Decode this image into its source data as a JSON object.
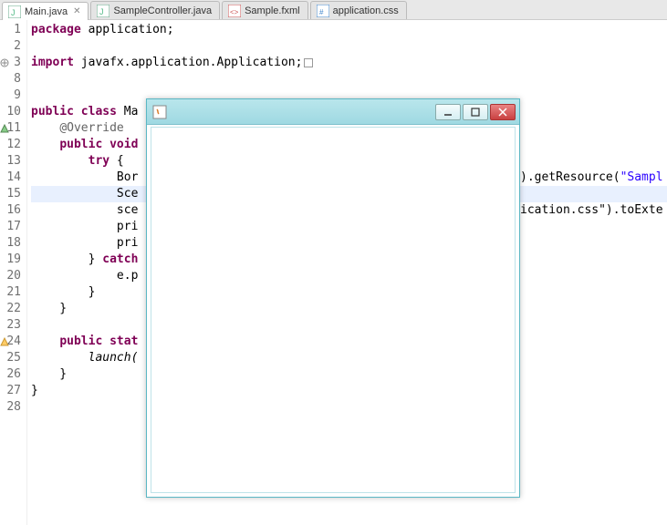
{
  "tabs": [
    {
      "label": "Main.java",
      "icon": "java-file-icon",
      "active": true,
      "closable": true
    },
    {
      "label": "SampleController.java",
      "icon": "java-file-icon",
      "active": false,
      "closable": false
    },
    {
      "label": "Sample.fxml",
      "icon": "fxml-file-icon",
      "active": false,
      "closable": false
    },
    {
      "label": "application.css",
      "icon": "css-file-icon",
      "active": false,
      "closable": false
    }
  ],
  "gutter": {
    "lines": [
      "1",
      "2",
      "3",
      "8",
      "9",
      "10",
      "11",
      "12",
      "13",
      "14",
      "15",
      "16",
      "17",
      "18",
      "19",
      "20",
      "21",
      "22",
      "23",
      "24",
      "25",
      "26",
      "27",
      "28"
    ],
    "fold_marker_line": "3",
    "override_marker_line": "11",
    "warning_marker_line": "24"
  },
  "code": {
    "lines": [
      {
        "tokens": [
          [
            "kw",
            "package"
          ],
          [
            "",
            " application;"
          ]
        ]
      },
      {
        "tokens": []
      },
      {
        "tokens": [
          [
            "kw",
            "import"
          ],
          [
            "",
            " javafx.application.Application;"
          ]
        ],
        "eolbox": true
      },
      {
        "tokens": []
      },
      {
        "tokens": []
      },
      {
        "tokens": [
          [
            "kw",
            "public class"
          ],
          [
            "",
            " Ma"
          ]
        ]
      },
      {
        "tokens": [
          [
            "",
            "    "
          ],
          [
            "ann",
            "@Override"
          ]
        ]
      },
      {
        "tokens": [
          [
            "",
            "    "
          ],
          [
            "kw",
            "public void"
          ]
        ]
      },
      {
        "tokens": [
          [
            "",
            "        "
          ],
          [
            "kw",
            "try"
          ],
          [
            "",
            " {"
          ]
        ]
      },
      {
        "tokens": [
          [
            "",
            "            Bor"
          ]
        ],
        "tail": [
          [
            "",
            ").getResource("
          ],
          [
            "str",
            "\"Sampl"
          ]
        ]
      },
      {
        "tokens": [
          [
            "",
            "            Sce"
          ]
        ],
        "highlight": true
      },
      {
        "tokens": [
          [
            "",
            "            sce"
          ]
        ],
        "tail": [
          [
            "",
            "ication.css\""
          ],
          [
            "",
            ").toExte"
          ]
        ]
      },
      {
        "tokens": [
          [
            "",
            "            pri"
          ]
        ]
      },
      {
        "tokens": [
          [
            "",
            "            pri"
          ]
        ]
      },
      {
        "tokens": [
          [
            "",
            "        } "
          ],
          [
            "kw",
            "catch"
          ]
        ]
      },
      {
        "tokens": [
          [
            "",
            "            e.p"
          ]
        ]
      },
      {
        "tokens": [
          [
            "",
            "        }"
          ]
        ]
      },
      {
        "tokens": [
          [
            "",
            "    }"
          ]
        ]
      },
      {
        "tokens": []
      },
      {
        "tokens": [
          [
            "",
            "    "
          ],
          [
            "kw",
            "public stat"
          ]
        ]
      },
      {
        "tokens": [
          [
            "",
            "        "
          ],
          [
            "",
            "launch("
          ]
        ],
        "italic": true
      },
      {
        "tokens": [
          [
            "",
            "    }"
          ]
        ]
      },
      {
        "tokens": [
          [
            "",
            "}"
          ]
        ]
      },
      {
        "tokens": []
      }
    ]
  },
  "app_window": {
    "title": "",
    "buttons": {
      "minimize": "minimize",
      "maximize": "maximize",
      "close": "close"
    }
  }
}
